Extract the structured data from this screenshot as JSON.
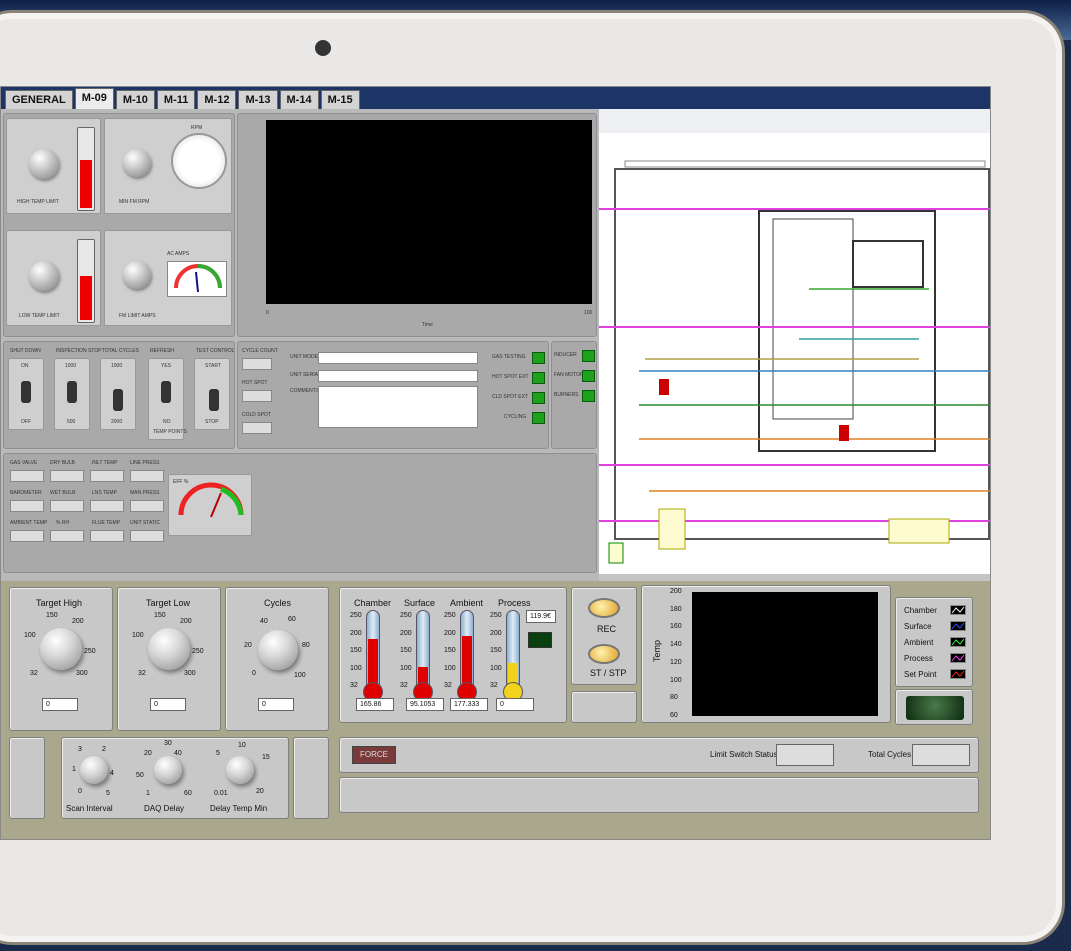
{
  "tabs": [
    {
      "label": "GENERAL",
      "active": false
    },
    {
      "label": "M-09",
      "active": true
    },
    {
      "label": "M-10",
      "active": false
    },
    {
      "label": "M-11",
      "active": false
    },
    {
      "label": "M-12",
      "active": false
    },
    {
      "label": "M-13",
      "active": false
    },
    {
      "label": "M-14",
      "active": false
    },
    {
      "label": "M-15",
      "active": false
    }
  ],
  "upper": {
    "high_temp_limit": "HIGH TEMP LIMIT",
    "min_fm_rpm": "MIN FM RPM",
    "rpm": "RPM",
    "low_temp_limit": "LOW TEMP LIMIT",
    "fm_limit_amps": "FM LIMIT AMPS",
    "ac_amps": "AC AMPS",
    "graph_xlabel": "Time",
    "graph_x0": "0",
    "graph_x1": "100",
    "switches": [
      {
        "title": "SHUT DOWN",
        "top": "ON",
        "bottom": "OFF"
      },
      {
        "title": "INSPECTION STOP",
        "top": "1000",
        "bottom": "500"
      },
      {
        "title": "TOTAL CYCLES",
        "top": "1000",
        "bottom": "2000"
      },
      {
        "title": "REFRESH",
        "top": "YES",
        "bottom": "NO"
      },
      {
        "title": "TEST CONTROL",
        "top": "START",
        "bottom": "STOP"
      }
    ],
    "temp_points": "TEMP POINTS",
    "cycle_count": "CYCLE COUNT",
    "hot_spot": "HOT SPOT",
    "cold_spot": "COLD SPOT",
    "unit_model": "UNIT MODEL",
    "unit_serial": "UNIT SERIAL",
    "comments": "COMMENTS",
    "status_leds": [
      "GAS TESTING",
      "HOT SPOT EXT",
      "CLD SPOT EXT",
      "CYCLING"
    ],
    "right_leds": [
      "INDUCER",
      "FAN MOTOR",
      "BURNERS"
    ],
    "gas_grid": [
      [
        "GAS VALVE",
        "DRY BULB",
        "INLT TEMP",
        "LINE PRESS"
      ],
      [
        "BAROMETER",
        "WET BULB",
        "LNS TEMP",
        "MAN PRESS"
      ],
      [
        "AMBIENT TEMP",
        "% RH",
        "FLUE TEMP",
        "UNIT STATIC"
      ]
    ],
    "eff_label": "EFF %"
  },
  "bottom": {
    "knobs": [
      {
        "title": "Target High",
        "s0": "32",
        "s1": "100",
        "s2": "150",
        "s3": "200",
        "s4": "250",
        "s5": "300",
        "value": "0"
      },
      {
        "title": "Target Low",
        "s0": "32",
        "s1": "100",
        "s2": "150",
        "s3": "200",
        "s4": "250",
        "s5": "300",
        "value": "0"
      },
      {
        "title": "Cycles",
        "s0": "0",
        "s1": "20",
        "s2": "40",
        "s3": "60",
        "s4": "80",
        "s5": "100",
        "value": "0"
      }
    ],
    "thermometers": [
      {
        "title": "Chamber",
        "value": "165.86",
        "level": 0.62,
        "color": "#e00000"
      },
      {
        "title": "Surface",
        "value": "95.1053",
        "level": 0.28,
        "color": "#e00000"
      },
      {
        "title": "Ambient",
        "value": "177.333",
        "level": 0.66,
        "color": "#e00000"
      },
      {
        "title": "Process",
        "value": "0",
        "level": 0.32,
        "color": "#f2d21a"
      }
    ],
    "therm_scale": [
      "250",
      "200",
      "150",
      "100",
      "32"
    ],
    "process_display": "119.9€",
    "rec_label": "REC",
    "ststp_label": "ST / STP",
    "chart_ylabel": "Temp",
    "chart_yticks": [
      "200",
      "180",
      "160",
      "140",
      "120",
      "100",
      "80",
      "60"
    ],
    "legend": [
      {
        "label": "Chamber",
        "color": "#ffffff"
      },
      {
        "label": "Surface",
        "color": "#3050ff"
      },
      {
        "label": "Ambient",
        "color": "#30ff30"
      },
      {
        "label": "Process",
        "color": "#ff40ff"
      },
      {
        "label": "Set Point",
        "color": "#ff2020"
      }
    ],
    "small_knobs": [
      {
        "title": "Scan Interval",
        "a": "0",
        "b": "1",
        "c": "2",
        "d": "3",
        "e": "4",
        "f": "5"
      },
      {
        "title": "DAQ Delay",
        "a": "1",
        "b": "20",
        "c": "30",
        "d": "40",
        "e": "50",
        "f": "60"
      },
      {
        "title": "Delay Temp Min",
        "a": "0.01",
        "b": "5",
        "c": "10",
        "d": "15",
        "e": "20",
        "f": ""
      }
    ],
    "force_label": "FORCE",
    "limit_switch_label": "Limit Switch Status",
    "total_cycles_label": "Total Cycles"
  }
}
